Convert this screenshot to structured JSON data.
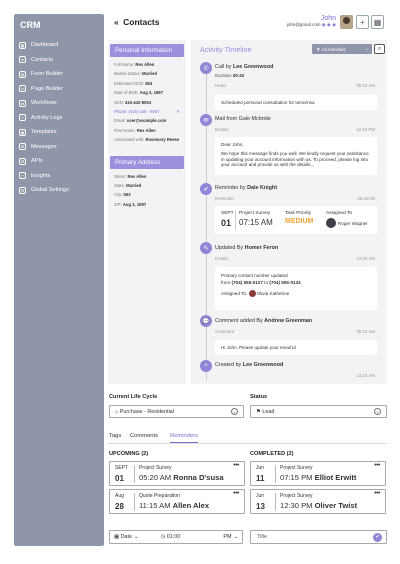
{
  "sidebar": {
    "brand": "CRM",
    "items": [
      {
        "label": "Dashboard",
        "icon": "dashboard-icon"
      },
      {
        "label": "Contacts",
        "icon": "contacts-icon"
      },
      {
        "label": "Form Builder",
        "icon": "form-builder-icon"
      },
      {
        "label": "Page Builder",
        "icon": "page-builder-icon"
      },
      {
        "label": "Workflows",
        "icon": "workflows-icon"
      },
      {
        "label": "Activity Logs",
        "icon": "activity-logs-icon"
      },
      {
        "label": "Templates",
        "icon": "templates-icon"
      },
      {
        "label": "Messages",
        "icon": "messages-icon"
      },
      {
        "label": "APIs",
        "icon": "apis-icon"
      },
      {
        "label": "Insights",
        "icon": "insights-icon"
      },
      {
        "label": "Global Settings",
        "icon": "settings-icon"
      }
    ]
  },
  "header": {
    "back_label": "Contacts",
    "user_name": "John",
    "user_email": "john@gmail.com"
  },
  "personal": {
    "title": "Personal Information",
    "rows": [
      {
        "label": "Full Name:",
        "value": "Rex Allen"
      },
      {
        "label": "Marital Status:",
        "value": "Married"
      },
      {
        "label": "Estimated NCD:",
        "value": "553"
      },
      {
        "label": "Date of Birth:",
        "value": "Aug 3, 1997"
      },
      {
        "label": "SSN:",
        "value": "415-442-8054"
      },
      {
        "label": "Phone:",
        "value": "(415) 446 - 9467"
      },
      {
        "label": "Email:",
        "value": "user@example.com"
      },
      {
        "label": "First Name:",
        "value": "Rex Allen"
      },
      {
        "label": "Associated with:",
        "value": "Rosemary Reese"
      }
    ]
  },
  "address": {
    "title": "Primary Address",
    "rows": [
      {
        "label": "Street:",
        "value": "Rex Allen"
      },
      {
        "label": "State:",
        "value": "Married"
      },
      {
        "label": "City:",
        "value": "553"
      },
      {
        "label": "ZIP:",
        "value": "Aug 3, 1997"
      }
    ]
  },
  "timeline": {
    "title": "Activity Timeline",
    "filter_label": "All Activities",
    "call": {
      "prefix": "Call by",
      "who": "Lee Greenwood",
      "duration_label": "Duration",
      "duration": "00:43",
      "date": "05:22 AM",
      "notes_label": "Notes",
      "notes": "Scheduled personal consultation for tomorrow."
    },
    "mail": {
      "prefix": "Mail from",
      "who": "Gale Mcbride",
      "details_label": "Details",
      "time": "12:16 PM",
      "greeting": "Dear John,",
      "body": "We hope this message finds you well. We kindly request your assistance in updating your account information with us. To proceed, please log into your account and provide us with the details..."
    },
    "reminder": {
      "prefix": "Reminder by",
      "who": "Dale Knight",
      "sub_label": "Reminder",
      "time": "05:22AM",
      "month": "SEPT",
      "day": "01",
      "type": "Project Survey",
      "clock": "07:15 AM",
      "priority_label": "Task Priority",
      "priority": "MEDIUM",
      "assigned_label": "Assigned To",
      "assignee": "Roger Wagner"
    },
    "update": {
      "prefix": "Updated By",
      "who": "Homer Feron",
      "details_label": "Details",
      "time": "11:20 AM",
      "line1": "Primary contact number updated",
      "from_label": "from",
      "old_number": "(704) 555-0127",
      "to_label": "to",
      "new_number": "(704) 555-0134",
      "assigned_label": "Assigned To:",
      "assignee": "Olivia Katherine"
    },
    "comment": {
      "prefix": "Comment added By",
      "who": "Andrew Greenman",
      "sub_label": "Comment",
      "time": "05:22 AM",
      "text": "Hi John, Please update your email id"
    },
    "created": {
      "prefix": "Created by",
      "who": "Lee Greenwood",
      "time": "11:15 AM"
    }
  },
  "lifecycle": {
    "label": "Current Life Cycle",
    "value": "Purchase - Residential"
  },
  "status": {
    "label": "Status",
    "value": "Lead"
  },
  "tabs": [
    {
      "label": "Tags"
    },
    {
      "label": "Comments"
    },
    {
      "label": "Reminders"
    }
  ],
  "upcoming": {
    "title": "UPCOMING (2)",
    "items": [
      {
        "month": "SEPT",
        "day": "01",
        "type": "Project Survey",
        "time": "05:20 AM",
        "name": "Ronna D'susa"
      },
      {
        "month": "Aug",
        "day": "28",
        "type": "Quote Preparation",
        "time": "11:15 AM",
        "name": "Allen Alex"
      }
    ]
  },
  "completed": {
    "title": "COMPLETED (2)",
    "items": [
      {
        "month": "Jun",
        "day": "11",
        "type": "Project Survey",
        "time": "07:15 PM",
        "name": "Elliot Erwitt"
      },
      {
        "month": "Jun",
        "day": "13",
        "type": "Project Survey",
        "time": "12:30 PM",
        "name": "Oliver Twist"
      }
    ]
  },
  "footer": {
    "date_placeholder": "Date",
    "time_value": "01:00",
    "ampm": "PM",
    "title_placeholder": "Title"
  }
}
